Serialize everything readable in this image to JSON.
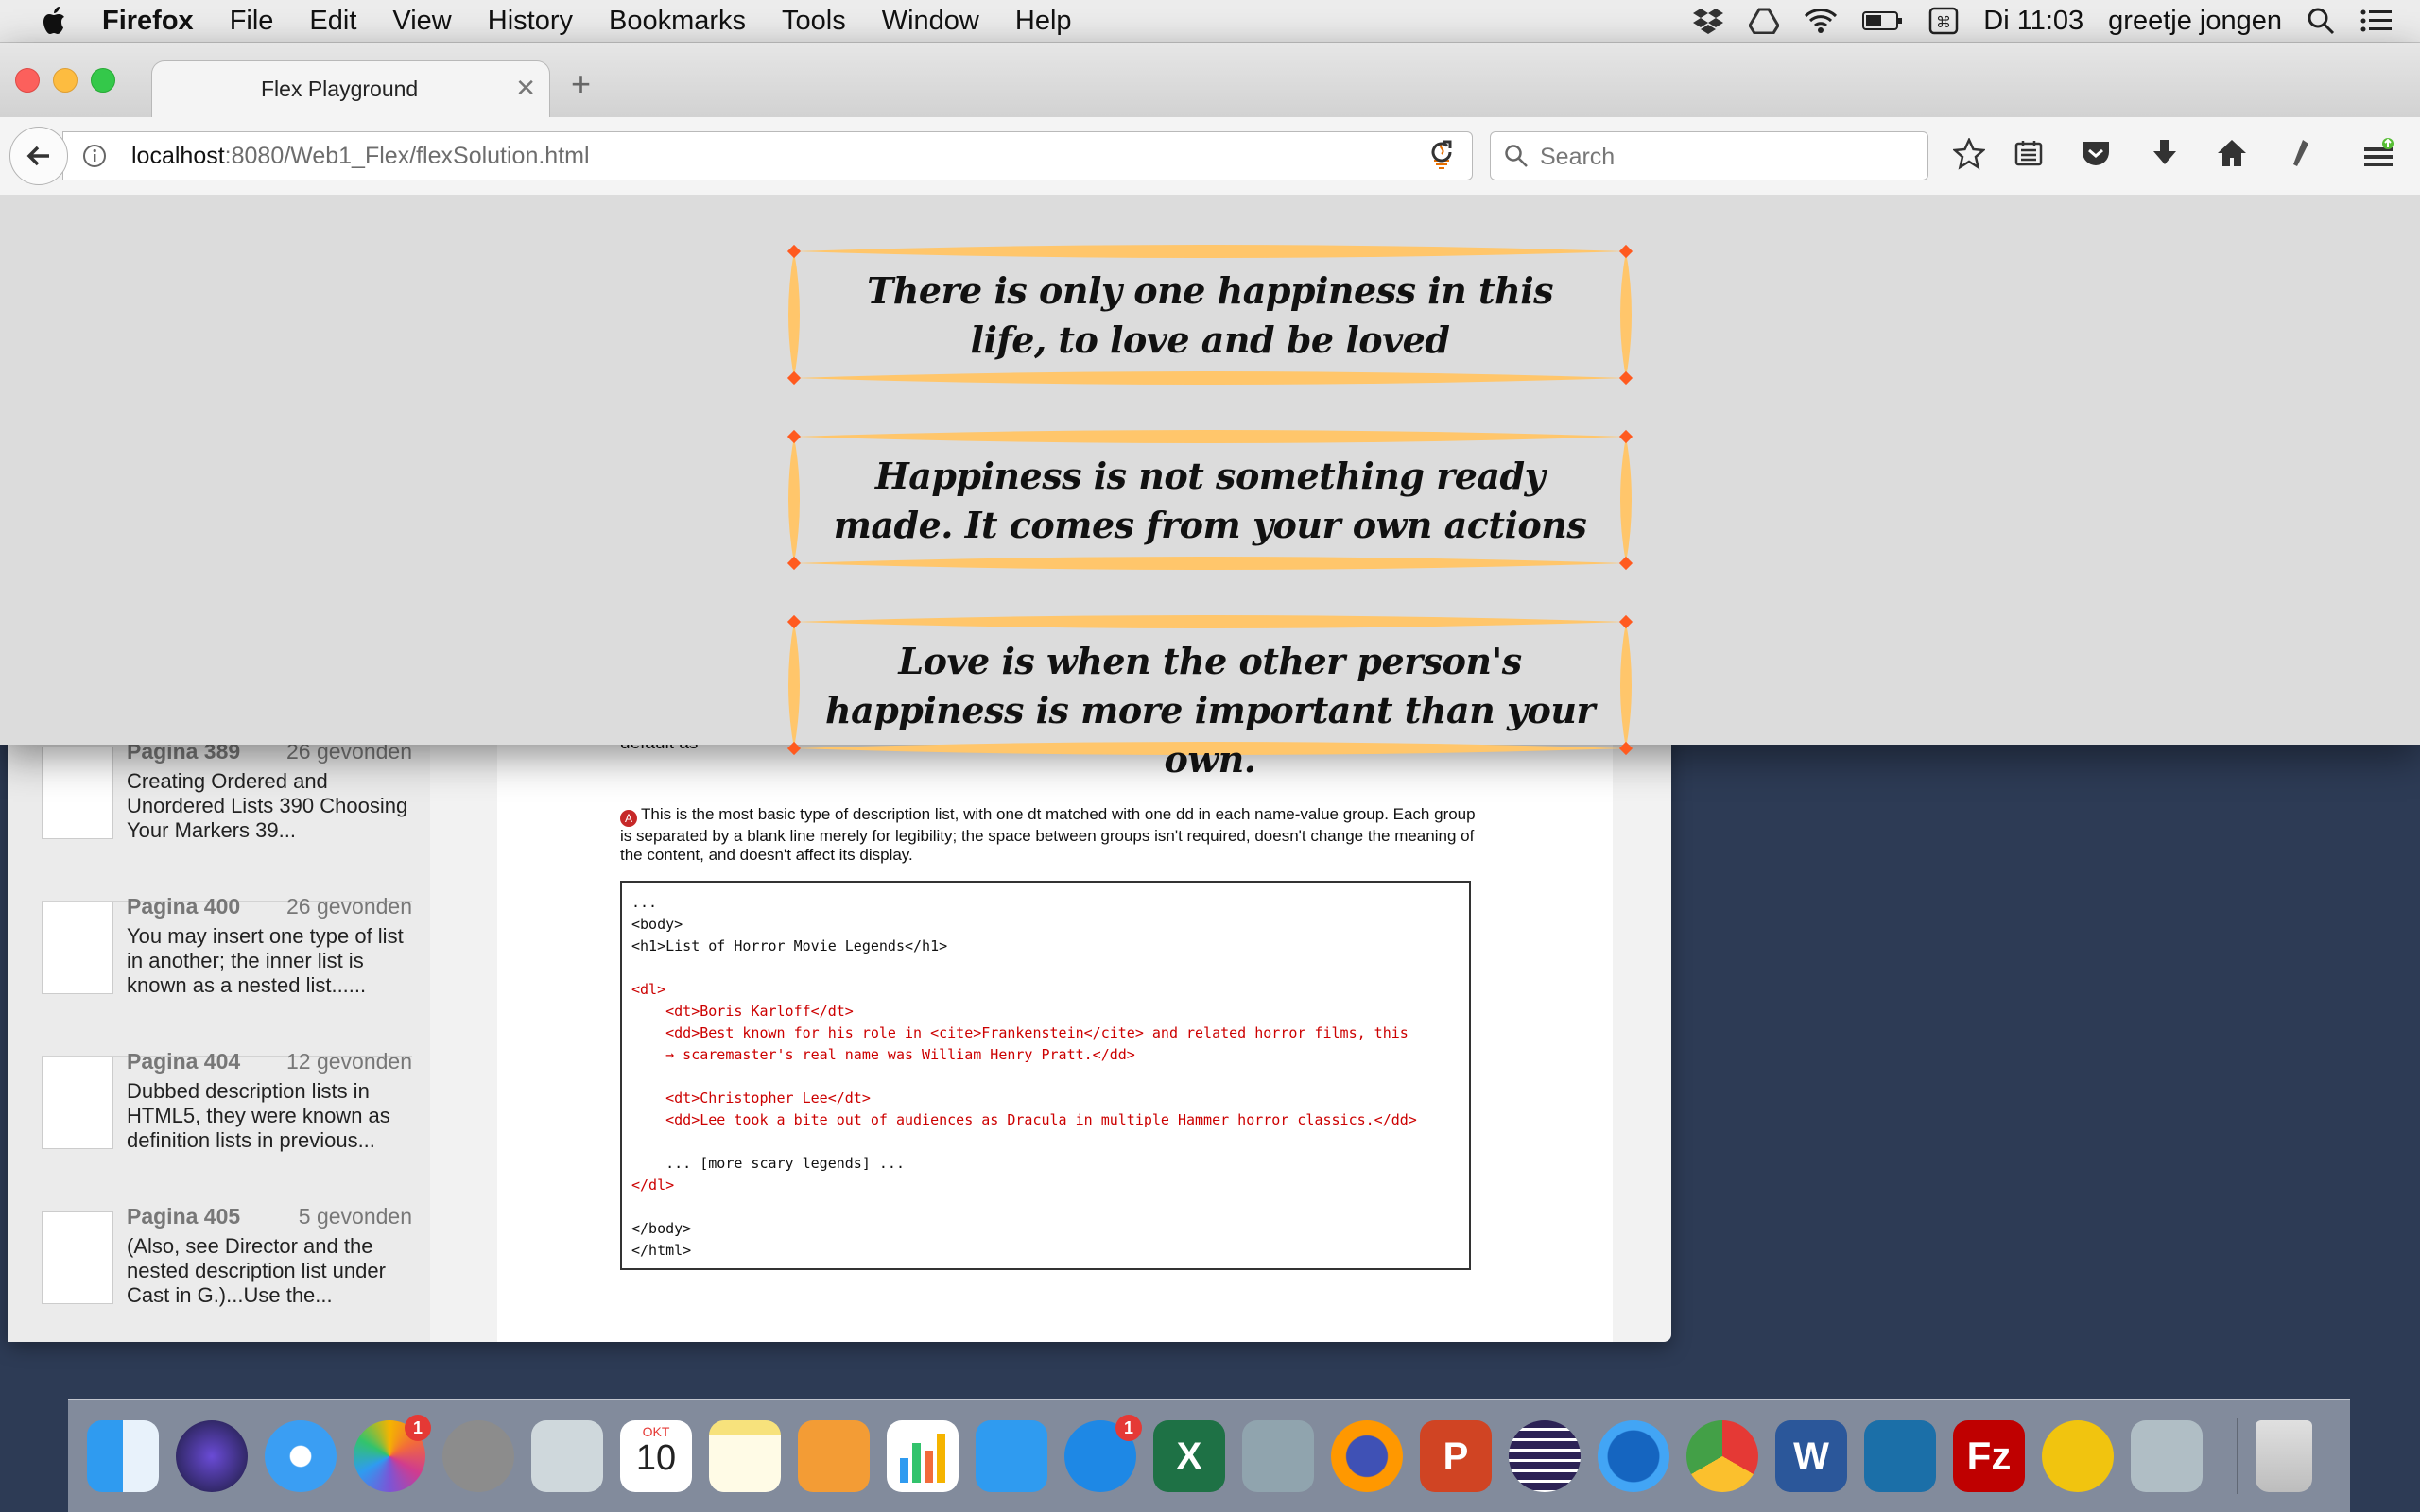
{
  "menubar": {
    "items": [
      "Firefox",
      "File",
      "Edit",
      "View",
      "History",
      "Bookmarks",
      "Tools",
      "Window",
      "Help"
    ],
    "clock": "Di 11:03",
    "user": "greetje jongen"
  },
  "browser": {
    "tab_title": "Flex Playground",
    "url_host": "localhost",
    "url_path": ":8080/Web1_Flex/flexSolution.html",
    "search_placeholder": "Search"
  },
  "quotes": [
    "There is only one happiness in this life, to love and be loved",
    "Happiness is not something ready made. It comes from your own actions",
    "Love is when the other person's happiness is more important than your own."
  ],
  "colors": {
    "frame_orange": "#ffc66b",
    "corner_red": "#ff5a1f",
    "page_bg": "#dcdcdc"
  },
  "search_results": [
    {
      "page": "Pagina 389",
      "count": "26 gevonden",
      "snippet": "Creating Ordered and Unordered Lists 390 Choosing Your Markers 39..."
    },
    {
      "page": "Pagina 400",
      "count": "26 gevonden",
      "snippet": "You may insert one type of list in another; the inner list is known as a nested list......"
    },
    {
      "page": "Pagina 404",
      "count": "12 gevonden",
      "snippet": "Dubbed description lists in HTML5, they were known as definition lists in previous..."
    },
    {
      "page": "Pagina 405",
      "count": "5 gevonden",
      "snippet": "(Also, see Director and the nested description list under Cast in G.)...Use the..."
    }
  ],
  "document": {
    "partial_line": "default as",
    "paragraph": "This is the most basic type of description list, with one dt matched with one dd in each name-value group. Each group is separated by a blank line merely for legibility; the space between groups isn't required, doesn't change the meaning of the content, and doesn't affect its display.",
    "code_lines": [
      "...",
      "<body>",
      "<h1>List of Horror Movie Legends</h1>",
      "",
      "<dl>",
      "    <dt>Boris Karloff</dt>",
      "    <dd>Best known for his role in <cite>Frankenstein</cite> and related horror films, this",
      "    → scaremaster's real name was William Henry Pratt.</dd>",
      "",
      "    <dt>Christopher Lee</dt>",
      "    <dd>Lee took a bite out of audiences as Dracula in multiple Hammer horror classics.</dd>",
      "",
      "    ... [more scary legends] ...",
      "</dl>",
      "",
      "</body>",
      "</html>"
    ]
  },
  "dock": {
    "apps": [
      "finder-icon",
      "siri-icon",
      "safari-icon",
      "photos-icon",
      "launchpad-icon",
      "mail-icon",
      "calendar-icon",
      "notes-icon",
      "pages-icon",
      "numbers-icon",
      "keynote-icon",
      "appstore-icon",
      "excel-icon",
      "preview-icon",
      "firefox-icon",
      "powerpoint-icon",
      "eclipse-icon",
      "firefox-dev-icon",
      "chrome-icon",
      "word-icon",
      "sourcetree-icon",
      "filezilla-icon",
      "ftp-icon",
      "printer-icon",
      "trash-icon"
    ],
    "calendar_month": "OKT",
    "calendar_day": "10",
    "photos_badge": "1",
    "appstore_badge": "1"
  }
}
